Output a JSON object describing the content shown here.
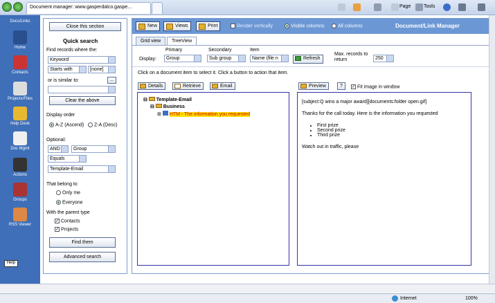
{
  "browser": {
    "tab_title": "Document manager: www.gasperdalco.gaspe...",
    "toolbar": {
      "page": "Page",
      "tools": "Tools"
    },
    "status": "Internet",
    "zoom": "100%"
  },
  "left_nav": {
    "items": [
      "Docs/Links",
      "Home",
      "Contacts",
      "Projects/Files",
      "Help Desk",
      "Doc Mgmt",
      "Actions",
      "Groups",
      "RSS Viewer"
    ],
    "help": "Help"
  },
  "search": {
    "close_label": "Close this section",
    "title": "Quick search",
    "find_label": "Find records where the:",
    "field": "Keyword",
    "match": "Starts with",
    "value": "[none]",
    "similar_label": "or is similar to:",
    "similar_value": "",
    "clear_label": "Clear the above",
    "order_label": "Display order",
    "order_az": "A-Z (Ascend)",
    "order_za": "Z-A (Desc)",
    "optional_label": "Optional:",
    "opt_logic": "AND",
    "opt_field": "Group",
    "opt_op": "Equals",
    "opt_value": "Template-Email",
    "belong_label": "That belong to",
    "only_me": "Only me",
    "everyone": "Everyone",
    "parent_label": "With the parent type",
    "contacts": "Contacts",
    "projects": "Projects",
    "find_btn": "Find them",
    "advanced_btn": "Advanced search"
  },
  "main": {
    "new": "New",
    "views": "Views",
    "print": "Print",
    "render_vertically": "Render vertically",
    "visible_columns": "Visible columns",
    "all_columns": "All columns",
    "app_title": "Document/Link Manager",
    "tabs": [
      "Grid view",
      "TreeView"
    ],
    "display_label": "Display:",
    "primary_label": "Primary",
    "primary": "Group",
    "secondary_label": "Secondary",
    "secondary": "Sub group",
    "item_label": "Item",
    "item": "Name (file n",
    "refresh": "Refresh",
    "max_label": "Max. records to return",
    "max": "250",
    "hint": "Click on a document item to select it. Click a button to action that item.",
    "details": "Details",
    "retrieve": "Retrieve",
    "email": "Email",
    "preview": "Preview",
    "help_q": "?",
    "fit_label": "Fit image in window",
    "tree": {
      "root": "Template-Email",
      "child": "Business",
      "item": "HTM - The information you requested"
    },
    "preview_content": {
      "subject": "[subject:Q wins a major award][documents:folder open.gif]",
      "intro": "Thanks for the call today.  Here is the information you requested",
      "bullets": [
        "First prize",
        "Second prize",
        "Third prize"
      ],
      "outro": "Watch out in traffic, please"
    }
  }
}
